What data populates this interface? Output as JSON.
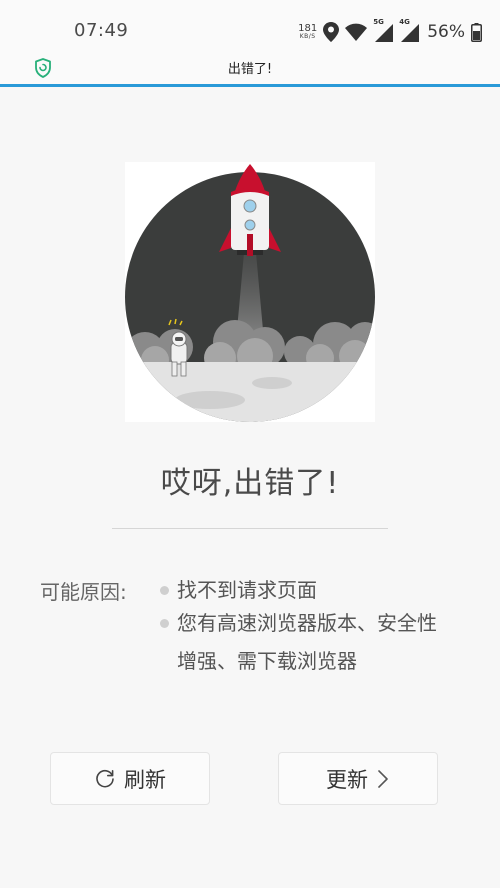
{
  "status_bar": {
    "time": "07:49",
    "net_speed_value": "181",
    "net_speed_unit": "KB/S",
    "signal1_tag": "5G",
    "signal2_tag": "4G",
    "battery": "56%"
  },
  "header": {
    "title": "出错了!"
  },
  "error": {
    "title": "哎呀,出错了!",
    "reason_label": "可能原因:",
    "reasons": [
      "找不到请求页面",
      "您有高速浏览器版本、安全性增强、需下载浏览器"
    ]
  },
  "buttons": {
    "refresh": "刷新",
    "update": "更新"
  },
  "colors": {
    "accent": "#2a9ad8",
    "shield": "#27b07a",
    "rocket_red": "#c8102e",
    "moon_sky": "#3b3d3c"
  },
  "icons": {
    "shield": "shield-icon",
    "refresh": "refresh-icon",
    "arrow": "chevron-right-icon"
  }
}
